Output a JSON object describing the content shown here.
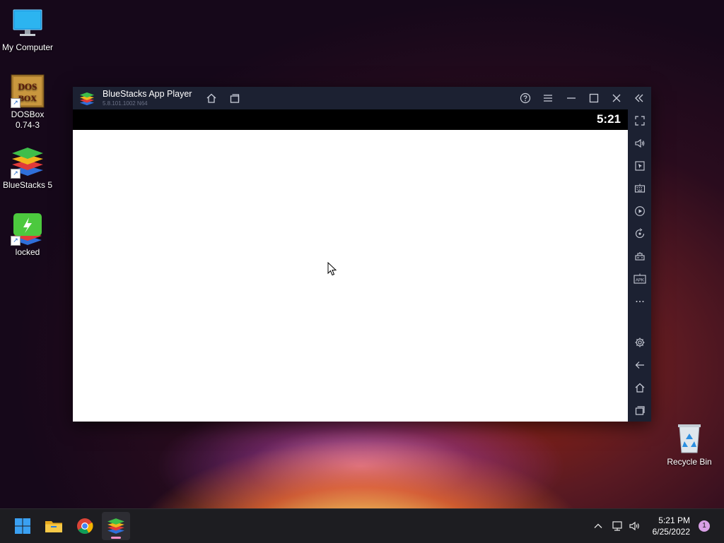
{
  "desktop": {
    "icons": [
      {
        "label": "My Computer",
        "icon": "monitor-icon"
      },
      {
        "label": "DOSBox",
        "label2": "0.74-3",
        "icon": "dosbox-icon",
        "logo_text": "DOS BOX"
      },
      {
        "label": "BlueStacks 5",
        "icon": "bluestacks-icon"
      },
      {
        "label": "locked",
        "icon": "bluestacks-green-icon"
      },
      {
        "label": "Recycle Bin",
        "icon": "recycle-bin-icon"
      }
    ]
  },
  "window": {
    "title": "BlueStacks App Player",
    "version": "5.8.101.1002 N64",
    "titlebar_buttons": [
      "home-icon",
      "multi-instance-icon",
      "help-icon",
      "menu-icon",
      "minimize-icon",
      "maximize-icon",
      "close-icon",
      "collapse-sidebar-icon"
    ],
    "android_clock": "5:21",
    "sidebar_buttons": [
      "fullscreen-icon",
      "volume-icon",
      "pointer-icon",
      "keyboard-icon",
      "macro-icon",
      "rotate-icon",
      "controls-icon",
      "apk-icon",
      "more-icon",
      "settings-icon",
      "back-icon",
      "home-icon",
      "recent-apps-icon"
    ],
    "apk_label": "APK"
  },
  "taskbar": {
    "apps": [
      "start-icon",
      "file-explorer-icon",
      "chrome-icon",
      "bluestacks-icon"
    ],
    "active_app": "bluestacks-icon",
    "tray": [
      "chevron-up-icon",
      "network-icon",
      "volume-icon"
    ],
    "time": "5:21 PM",
    "date": "6/25/2022",
    "notification_count": "1"
  },
  "colors": {
    "titlebar": "#1c2132",
    "taskbar": "#1d1d21",
    "accent": "#0a84ff"
  }
}
